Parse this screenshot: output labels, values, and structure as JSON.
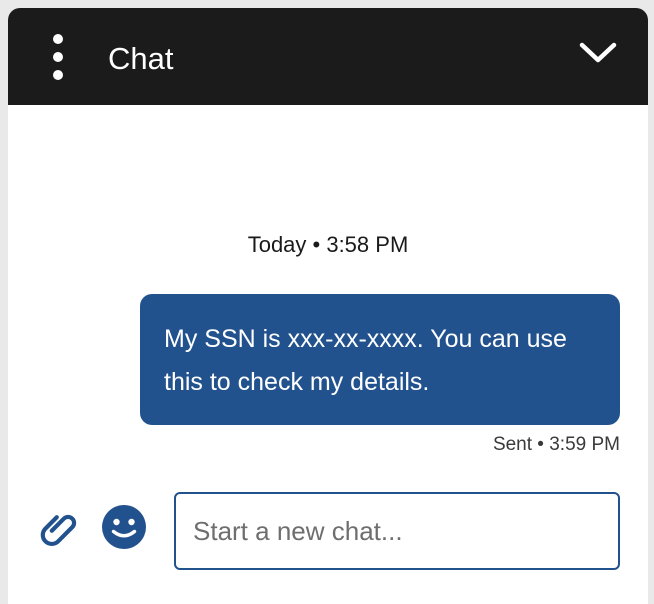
{
  "header": {
    "title": "Chat",
    "menu_icon": "vertical-ellipsis-icon",
    "collapse_icon": "chevron-down-icon"
  },
  "conversation": {
    "day_separator": "Today • 3:58 PM",
    "messages": [
      {
        "text": "My SSN is xxx-xx-xxxx. You can use this to check my details.",
        "status": "Sent • 3:59 PM"
      }
    ]
  },
  "composer": {
    "attach_icon": "paperclip-icon",
    "emoji_icon": "smiley-icon",
    "input_value": "",
    "placeholder": "Start a new chat..."
  },
  "colors": {
    "header_background": "#1b1b1b",
    "accent": "#22528e",
    "background": "#ffffff"
  }
}
